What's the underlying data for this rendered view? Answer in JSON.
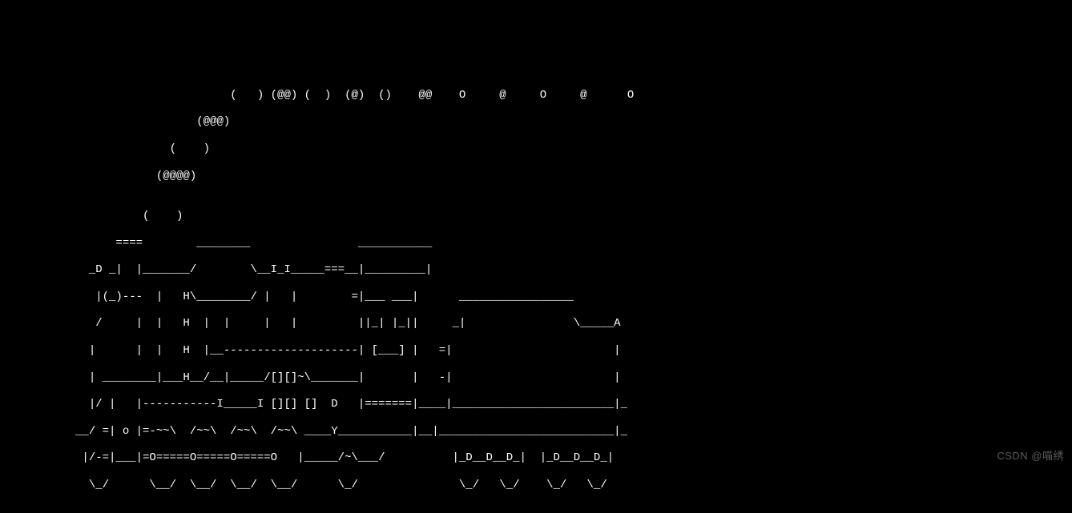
{
  "terminal": {
    "ascii_art": {
      "lines": [
        "",
        "",
        "",
        "",
        "",
        "                                 (   ) (@@) (  )  (@)  ()    @@    O     @     O     @      O",
        "                            (@@@)",
        "                        (    )",
        "                      (@@@@)",
        "",
        "                    (    )",
        "                ====        ________                ___________",
        "            _D _|  |_______/        \\__I_I_____===__|_________|",
        "             |(_)---  |   H\\________/ |   |        =|___ ___|      _________________",
        "             /     |  |   H  |  |     |   |         ||_| |_||     _|                \\_____A",
        "            |      |  |   H  |__--------------------| [___] |   =|                        |",
        "            | ________|___H__/__|_____/[][]~\\_______|       |   -|                        |",
        "            |/ |   |-----------I_____I [][] []  D   |=======|____|________________________|_",
        "          __/ =| o |=-~~\\  /~~\\  /~~\\  /~~\\ ____Y___________|__|__________________________|_",
        "           |/-=|___|=O=====O=====O=====O   |_____/~\\___/          |_D__D__D_|  |_D__D__D_|",
        "            \\_/      \\__/  \\__/  \\__/  \\__/      \\_/               \\_/   \\_/    \\_/   \\_/"
      ]
    }
  },
  "watermark": {
    "text": "CSDN @喵绣"
  }
}
